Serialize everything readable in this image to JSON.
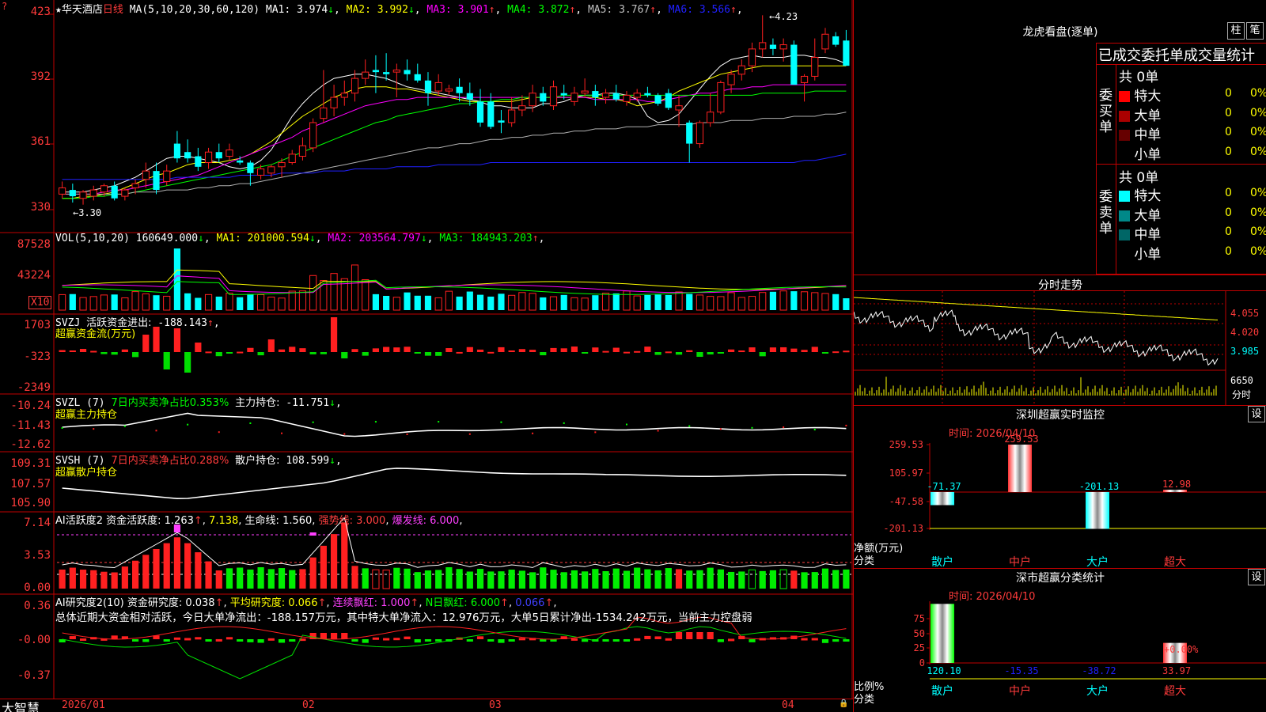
{
  "stock": {
    "name": "华天酒店",
    "period": "日线"
  },
  "main": {
    "ma_spec": "MA(5,10,20,30,60,120)",
    "ma_values": [
      {
        "label": "MA1:",
        "value": "3.974",
        "arrow": "↓",
        "color": "#ffffff"
      },
      {
        "label": "MA2:",
        "value": "3.992",
        "arrow": "↓",
        "color": "#ffff00"
      },
      {
        "label": "MA3:",
        "value": "3.901",
        "arrow": "↑",
        "color": "#ff00ff"
      },
      {
        "label": "MA4:",
        "value": "3.872",
        "arrow": "↑",
        "color": "#00ff00"
      },
      {
        "label": "MA5:",
        "value": "3.767",
        "arrow": "↑",
        "color": "#c0c0c0"
      },
      {
        "label": "MA6:",
        "value": "3.566",
        "arrow": "↑",
        "color": "#2020ff"
      }
    ],
    "yticks": [
      "423",
      "392",
      "361",
      "330"
    ],
    "hi_label": "4.23",
    "lo_label": "3.30",
    "candles": [
      [
        3.38,
        3.44,
        3.36,
        3.41
      ],
      [
        3.4,
        3.43,
        3.34,
        3.37
      ],
      [
        3.36,
        3.4,
        3.33,
        3.39
      ],
      [
        3.37,
        3.42,
        3.35,
        3.4
      ],
      [
        3.39,
        3.43,
        3.37,
        3.42
      ],
      [
        3.42,
        3.44,
        3.35,
        3.36
      ],
      [
        3.37,
        3.41,
        3.35,
        3.4
      ],
      [
        3.41,
        3.45,
        3.38,
        3.43
      ],
      [
        3.45,
        3.53,
        3.41,
        3.49
      ],
      [
        3.49,
        3.53,
        3.38,
        3.4
      ],
      [
        3.44,
        3.52,
        3.42,
        3.49
      ],
      [
        3.62,
        3.68,
        3.53,
        3.55
      ],
      [
        3.58,
        3.64,
        3.53,
        3.55
      ],
      [
        3.56,
        3.6,
        3.49,
        3.51
      ],
      [
        3.53,
        3.6,
        3.5,
        3.58
      ],
      [
        3.58,
        3.62,
        3.53,
        3.55
      ],
      [
        3.56,
        3.62,
        3.54,
        3.59
      ],
      [
        3.54,
        3.56,
        3.52,
        3.53
      ],
      [
        3.53,
        3.54,
        3.42,
        3.48
      ],
      [
        3.47,
        3.52,
        3.45,
        3.5
      ],
      [
        3.48,
        3.52,
        3.46,
        3.51
      ],
      [
        3.51,
        3.55,
        3.46,
        3.53
      ],
      [
        3.53,
        3.59,
        3.52,
        3.57
      ],
      [
        3.56,
        3.65,
        3.54,
        3.61
      ],
      [
        3.6,
        3.74,
        3.58,
        3.72
      ],
      [
        3.74,
        3.97,
        3.72,
        3.79
      ],
      [
        3.79,
        3.9,
        3.75,
        3.84
      ],
      [
        3.84,
        3.92,
        3.8,
        3.86
      ],
      [
        3.86,
        3.97,
        3.82,
        3.93
      ],
      [
        3.93,
        4.02,
        3.9,
        3.96
      ],
      [
        3.97,
        4.04,
        3.86,
        3.96
      ],
      [
        3.96,
        4.05,
        3.92,
        3.95
      ],
      [
        3.96,
        4.0,
        3.84,
        3.97
      ],
      [
        3.97,
        4.02,
        3.92,
        3.95
      ],
      [
        3.95,
        4.0,
        3.91,
        3.92
      ],
      [
        3.92,
        3.96,
        3.8,
        3.86
      ],
      [
        3.87,
        3.95,
        3.85,
        3.91
      ],
      [
        3.87,
        3.9,
        3.85,
        3.88
      ],
      [
        3.89,
        3.93,
        3.82,
        3.86
      ],
      [
        3.86,
        3.91,
        3.8,
        3.83
      ],
      [
        3.82,
        3.88,
        3.7,
        3.72
      ],
      [
        3.82,
        3.86,
        3.69,
        3.7
      ],
      [
        3.73,
        3.78,
        3.67,
        3.72
      ],
      [
        3.72,
        3.84,
        3.7,
        3.78
      ],
      [
        3.78,
        3.85,
        3.75,
        3.8
      ],
      [
        3.8,
        3.9,
        3.77,
        3.86
      ],
      [
        3.86,
        3.89,
        3.8,
        3.82
      ],
      [
        3.8,
        3.92,
        3.78,
        3.89
      ],
      [
        3.86,
        3.9,
        3.83,
        3.85
      ],
      [
        3.82,
        3.89,
        3.8,
        3.86
      ],
      [
        3.86,
        3.93,
        3.84,
        3.87
      ],
      [
        3.87,
        3.9,
        3.8,
        3.84
      ],
      [
        3.84,
        3.88,
        3.81,
        3.86
      ],
      [
        3.86,
        3.9,
        3.82,
        3.83
      ],
      [
        3.82,
        3.87,
        3.8,
        3.85
      ],
      [
        3.84,
        3.88,
        3.82,
        3.86
      ],
      [
        3.86,
        3.89,
        3.84,
        3.85
      ],
      [
        3.85,
        3.86,
        3.8,
        3.81
      ],
      [
        3.86,
        3.88,
        3.78,
        3.79
      ],
      [
        3.78,
        3.85,
        3.7,
        3.8
      ],
      [
        3.72,
        3.73,
        3.53,
        3.62
      ],
      [
        3.62,
        3.73,
        3.6,
        3.72
      ],
      [
        3.72,
        3.86,
        3.7,
        3.77
      ],
      [
        3.77,
        3.92,
        3.76,
        3.91
      ],
      [
        3.9,
        3.97,
        3.86,
        3.95
      ],
      [
        3.95,
        4.02,
        3.92,
        3.99
      ],
      [
        3.99,
        4.1,
        3.96,
        4.07
      ],
      [
        4.07,
        4.23,
        4.03,
        4.1
      ],
      [
        4.09,
        4.12,
        4.04,
        4.07
      ],
      [
        4.07,
        4.12,
        4.01,
        4.09
      ],
      [
        4.09,
        4.11,
        3.95,
        3.9
      ],
      [
        3.91,
        3.95,
        3.82,
        3.94
      ],
      [
        3.94,
        4.12,
        3.92,
        4.03
      ],
      [
        4.07,
        4.17,
        4.05,
        4.14
      ],
      [
        4.13,
        4.15,
        4.08,
        4.09
      ],
      [
        4.11,
        4.16,
        4.0,
        3.99
      ]
    ],
    "ma_lines": {
      "ma1": [
        3.39,
        3.39,
        3.39,
        3.4,
        3.41,
        3.42,
        3.44,
        3.46,
        3.49,
        3.52,
        3.55,
        3.56,
        3.56,
        3.55,
        3.54,
        3.53,
        3.51,
        3.5,
        3.51,
        3.54,
        3.59,
        3.67,
        3.75,
        3.81,
        3.86,
        3.9,
        3.93,
        3.94,
        3.95,
        3.95,
        3.94,
        3.93,
        3.91,
        3.89,
        3.88,
        3.87,
        3.86,
        3.85,
        3.84,
        3.83,
        3.82,
        3.8,
        3.8,
        3.79,
        3.79,
        3.79,
        3.81,
        3.81,
        3.82,
        3.84,
        3.85,
        3.85,
        3.86,
        3.86,
        3.85,
        3.83,
        3.75,
        3.72,
        3.73,
        3.76,
        3.82,
        3.88,
        3.94,
        3.99,
        4.02,
        4.03,
        4.04,
        4.03,
        4.03,
        4.03,
        4.04,
        4.04,
        4.03,
        4.03,
        4.02,
        4.0
      ],
      "ma2": [
        3.36,
        3.36,
        3.37,
        3.37,
        3.38,
        3.39,
        3.41,
        3.43,
        3.45,
        3.47,
        3.48,
        3.5,
        3.52,
        3.53,
        3.53,
        3.53,
        3.54,
        3.55,
        3.57,
        3.6,
        3.63,
        3.67,
        3.71,
        3.75,
        3.78,
        3.81,
        3.84,
        3.86,
        3.88,
        3.89,
        3.89,
        3.89,
        3.88,
        3.88,
        3.87,
        3.86,
        3.85,
        3.84,
        3.83,
        3.82,
        3.82,
        3.82,
        3.82,
        3.82,
        3.83,
        3.84,
        3.84,
        3.84,
        3.84,
        3.84,
        3.84,
        3.84,
        3.83,
        3.83,
        3.82,
        3.8,
        3.81,
        3.82,
        3.84,
        3.87,
        3.89,
        3.91,
        3.93,
        3.95,
        3.96,
        3.97,
        3.98,
        3.99,
        3.99,
        3.99,
        3.99,
        3.99,
        3.99,
        3.99,
        3.99,
        3.99
      ],
      "ma3": [
        3.38,
        3.38,
        3.38,
        3.38,
        3.39,
        3.4,
        3.4,
        3.41,
        3.42,
        3.43,
        3.44,
        3.45,
        3.46,
        3.47,
        3.49,
        3.51,
        3.53,
        3.55,
        3.57,
        3.59,
        3.61,
        3.63,
        3.65,
        3.68,
        3.7,
        3.72,
        3.74,
        3.76,
        3.78,
        3.8,
        3.81,
        3.82,
        3.83,
        3.83,
        3.84,
        3.84,
        3.84,
        3.84,
        3.84,
        3.84,
        3.84,
        3.84,
        3.84,
        3.84,
        3.84,
        3.84,
        3.84,
        3.84,
        3.84,
        3.84,
        3.84,
        3.83,
        3.83,
        3.83,
        3.83,
        3.83,
        3.82,
        3.82,
        3.83,
        3.84,
        3.85,
        3.86,
        3.86,
        3.87,
        3.88,
        3.88,
        3.89,
        3.89,
        3.9,
        3.9,
        3.9,
        3.9,
        3.9,
        3.9,
        3.9,
        3.9
      ],
      "ma4": [
        3.36,
        3.36,
        3.36,
        3.37,
        3.37,
        3.38,
        3.38,
        3.39,
        3.4,
        3.41,
        3.42,
        3.43,
        3.44,
        3.45,
        3.46,
        3.47,
        3.48,
        3.49,
        3.5,
        3.51,
        3.52,
        3.54,
        3.56,
        3.58,
        3.6,
        3.62,
        3.64,
        3.66,
        3.68,
        3.7,
        3.72,
        3.73,
        3.75,
        3.76,
        3.77,
        3.78,
        3.79,
        3.8,
        3.81,
        3.81,
        3.82,
        3.82,
        3.83,
        3.83,
        3.84,
        3.84,
        3.84,
        3.84,
        3.85,
        3.85,
        3.85,
        3.85,
        3.85,
        3.85,
        3.85,
        3.85,
        3.85,
        3.85,
        3.85,
        3.85,
        3.85,
        3.85,
        3.85,
        3.85,
        3.85,
        3.85,
        3.85,
        3.86,
        3.86,
        3.86,
        3.86,
        3.86,
        3.87,
        3.87,
        3.87,
        3.87
      ],
      "ma5": [
        3.38,
        3.38,
        3.38,
        3.38,
        3.38,
        3.38,
        3.38,
        3.39,
        3.39,
        3.39,
        3.4,
        3.4,
        3.4,
        3.41,
        3.41,
        3.42,
        3.42,
        3.43,
        3.43,
        3.44,
        3.45,
        3.46,
        3.47,
        3.48,
        3.49,
        3.5,
        3.51,
        3.52,
        3.53,
        3.54,
        3.55,
        3.56,
        3.57,
        3.58,
        3.59,
        3.6,
        3.6,
        3.61,
        3.62,
        3.62,
        3.63,
        3.64,
        3.64,
        3.65,
        3.65,
        3.66,
        3.66,
        3.67,
        3.67,
        3.68,
        3.68,
        3.69,
        3.69,
        3.69,
        3.7,
        3.7,
        3.7,
        3.71,
        3.71,
        3.71,
        3.71,
        3.72,
        3.72,
        3.72,
        3.73,
        3.73,
        3.73,
        3.74,
        3.74,
        3.74,
        3.75,
        3.75,
        3.75,
        3.76,
        3.76,
        3.77
      ],
      "ma6": [
        3.45,
        3.45,
        3.45,
        3.45,
        3.45,
        3.45,
        3.45,
        3.45,
        3.45,
        3.45,
        3.45,
        3.46,
        3.46,
        3.46,
        3.46,
        3.46,
        3.46,
        3.47,
        3.47,
        3.47,
        3.47,
        3.48,
        3.48,
        3.48,
        3.48,
        3.49,
        3.49,
        3.49,
        3.5,
        3.5,
        3.5,
        3.5,
        3.51,
        3.51,
        3.51,
        3.51,
        3.52,
        3.52,
        3.52,
        3.52,
        3.52,
        3.53,
        3.53,
        3.53,
        3.53,
        3.53,
        3.53,
        3.53,
        3.53,
        3.53,
        3.53,
        3.53,
        3.53,
        3.53,
        3.53,
        3.53,
        3.53,
        3.53,
        3.53,
        3.53,
        3.53,
        3.53,
        3.53,
        3.53,
        3.53,
        3.53,
        3.53,
        3.53,
        3.53,
        3.53,
        3.53,
        3.54,
        3.54,
        3.55,
        3.56,
        3.57
      ]
    }
  },
  "vol": {
    "header": "VOL(5,10,20)",
    "value": "160649.000",
    "items": [
      {
        "label": "MA1:",
        "value": "201000.594",
        "arrow": "↓",
        "color": "#ffff00"
      },
      {
        "label": "MA2:",
        "value": "203564.797",
        "arrow": "↓",
        "color": "#ff00ff"
      },
      {
        "label": "MA3:",
        "value": "184943.203",
        "arrow": "↑",
        "color": "#00ff00"
      }
    ],
    "yticks": [
      "87528",
      "43224"
    ],
    "unit": "X10"
  },
  "svzj": {
    "header": "SVZJ",
    "label": "活跃资金进出:",
    "value": "-188.143",
    "arrow": "↑",
    "sub": "超赢资金流(万元)",
    "yticks": [
      "1703",
      "-323",
      "-2349"
    ]
  },
  "svzl": {
    "header": "SVZL (7)",
    "ratio": "7日内买卖净占比0.353%",
    "label": "主力持仓:",
    "value": "-11.751",
    "arrow": "↓",
    "sub": "超赢主力持仓",
    "yticks": [
      "-10.24",
      "-11.43",
      "-12.62"
    ]
  },
  "svsh": {
    "header": "SVSH (7)",
    "ratio": "7日内买卖净占比0.288%",
    "label": "散户持仓:",
    "value": "108.599",
    "arrow": "↓",
    "sub": "超赢散户持仓",
    "yticks": [
      "109.31",
      "107.57",
      "105.90"
    ]
  },
  "ai_active": {
    "header": "AI活跃度2",
    "items": [
      {
        "text": "资金活跃度: 1.263",
        "arrow": "↑",
        "color": "#ffffff"
      },
      {
        "text": "7.138",
        "arrow": "",
        "color": "#ffff00"
      },
      {
        "text": "生命线: 1.560",
        "arrow": "",
        "color": "#ffffff"
      },
      {
        "text": "强势线: 3.000",
        "arrow": "",
        "color": "#ff4040"
      },
      {
        "text": "爆发线: 6.000",
        "arrow": "",
        "color": "#ff40ff"
      }
    ],
    "yticks": [
      "7.14",
      "3.53",
      "0.00"
    ]
  },
  "ai_research": {
    "header": "AI研究度2(10)",
    "items": [
      {
        "text": "资金研究度: 0.038",
        "arrow": "↑",
        "color": "#ffffff"
      },
      {
        "text": "平均研究度: 0.066",
        "arrow": "↑",
        "color": "#ffff00"
      },
      {
        "text": "连续飘红: 1.000",
        "arrow": "↑",
        "color": "#ff40ff"
      },
      {
        "text": "N日飘红: 6.000",
        "arrow": "↑",
        "color": "#00ff00"
      },
      {
        "text": "0.066",
        "arrow": "↑",
        "color": "#4040ff"
      }
    ],
    "summary": "总体近期大资金相对活跃，今日大单净流出：-188.157万元，其中特大单净流入：12.976万元，大单5日累计净出-1534.242万元，当前主力控盘弱",
    "yticks": [
      "0.36",
      "-0.00",
      "-0.37"
    ]
  },
  "date_axis": [
    "2026/01",
    "02",
    "03",
    "04"
  ],
  "app_name": "大智慧",
  "lhb": {
    "title": "龙虎看盘(逐单)",
    "btn1": "柱",
    "btn2": "笔",
    "tabs": "已成交委托单成交量统计",
    "buy_label": "委买单",
    "sell_label": "委卖单",
    "buy_total": "共 0单",
    "sell_total": "共 0单",
    "buy_rows": [
      {
        "color": "#ff0000",
        "label": "特大",
        "count": "0",
        "pct": "0%"
      },
      {
        "color": "#aa0000",
        "label": "大单",
        "count": "0",
        "pct": "0%"
      },
      {
        "color": "#660000",
        "label": "中单",
        "count": "0",
        "pct": "0%"
      },
      {
        "color": "",
        "label": "小单",
        "count": "0",
        "pct": "0%"
      }
    ],
    "sell_rows": [
      {
        "color": "#00ffff",
        "label": "特大",
        "count": "0",
        "pct": "0%"
      },
      {
        "color": "#008888",
        "label": "大单",
        "count": "0",
        "pct": "0%"
      },
      {
        "color": "#006666",
        "label": "中单",
        "count": "0",
        "pct": "0%"
      },
      {
        "color": "",
        "label": "小单",
        "count": "0",
        "pct": "0%"
      }
    ]
  },
  "intraday": {
    "title": "分时走势",
    "yticks": [
      "4.055",
      "4.020",
      "3.985"
    ],
    "vol_tick": "6650",
    "vol_label": "分时"
  },
  "sz_monitor": {
    "title": "深圳超赢实时监控",
    "setting": "设",
    "time": "时间: 2026/04/10",
    "yticks": [
      "259.53",
      "105.97",
      "-47.58",
      "-201.13"
    ],
    "ylabel": "净额(万元)",
    "xlabel": "分类",
    "categories": [
      "散户",
      "中户",
      "大户",
      "超大"
    ],
    "values": [
      -71.37,
      259.53,
      -201.13,
      12.98
    ],
    "value_labels": [
      "-71.37",
      "259.53",
      "-201.13",
      "12.98"
    ]
  },
  "sz_classify": {
    "title": "深市超赢分类统计",
    "setting": "设",
    "time": "时间: 2026/04/10",
    "yticks": [
      "75",
      "50",
      "25",
      "0"
    ],
    "ylabel": "比例%",
    "xlabel": "分类",
    "categories": [
      "散户",
      "中户",
      "大户",
      "超大"
    ],
    "values": [
      120.1,
      -15.35,
      -38.72,
      33.97
    ],
    "value_labels": [
      "120.10",
      "-15.35",
      "-38.72",
      "33.97"
    ],
    "extra": "+0.00%"
  }
}
